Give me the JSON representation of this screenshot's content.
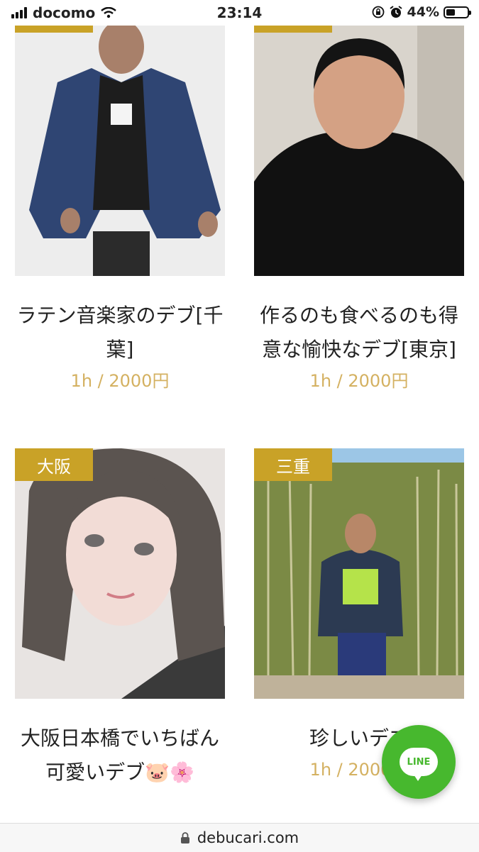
{
  "status_bar": {
    "carrier": "docomo",
    "time": "23:14",
    "battery_percent": "44%",
    "battery_level": 0.44
  },
  "listings": [
    {
      "region": "",
      "title": "ラテン音楽家のデブ[千葉]",
      "price": "1h / 2000円"
    },
    {
      "region": "",
      "title": "作るのも食べるのも得意な愉快なデブ[東京]",
      "price": "1h / 2000円"
    },
    {
      "region": "大阪",
      "title": "大阪日本橋でいちばん可愛いデブ🐷🌸",
      "price": ""
    },
    {
      "region": "三重",
      "title": "珍しいデブ",
      "price": "1h / 2000円"
    }
  ],
  "line_button": {
    "label": "LINE"
  },
  "browser": {
    "domain": "debucari.com"
  },
  "colors": {
    "accent": "#c9a227",
    "price": "#d4b161",
    "line_green": "#47b82e"
  }
}
